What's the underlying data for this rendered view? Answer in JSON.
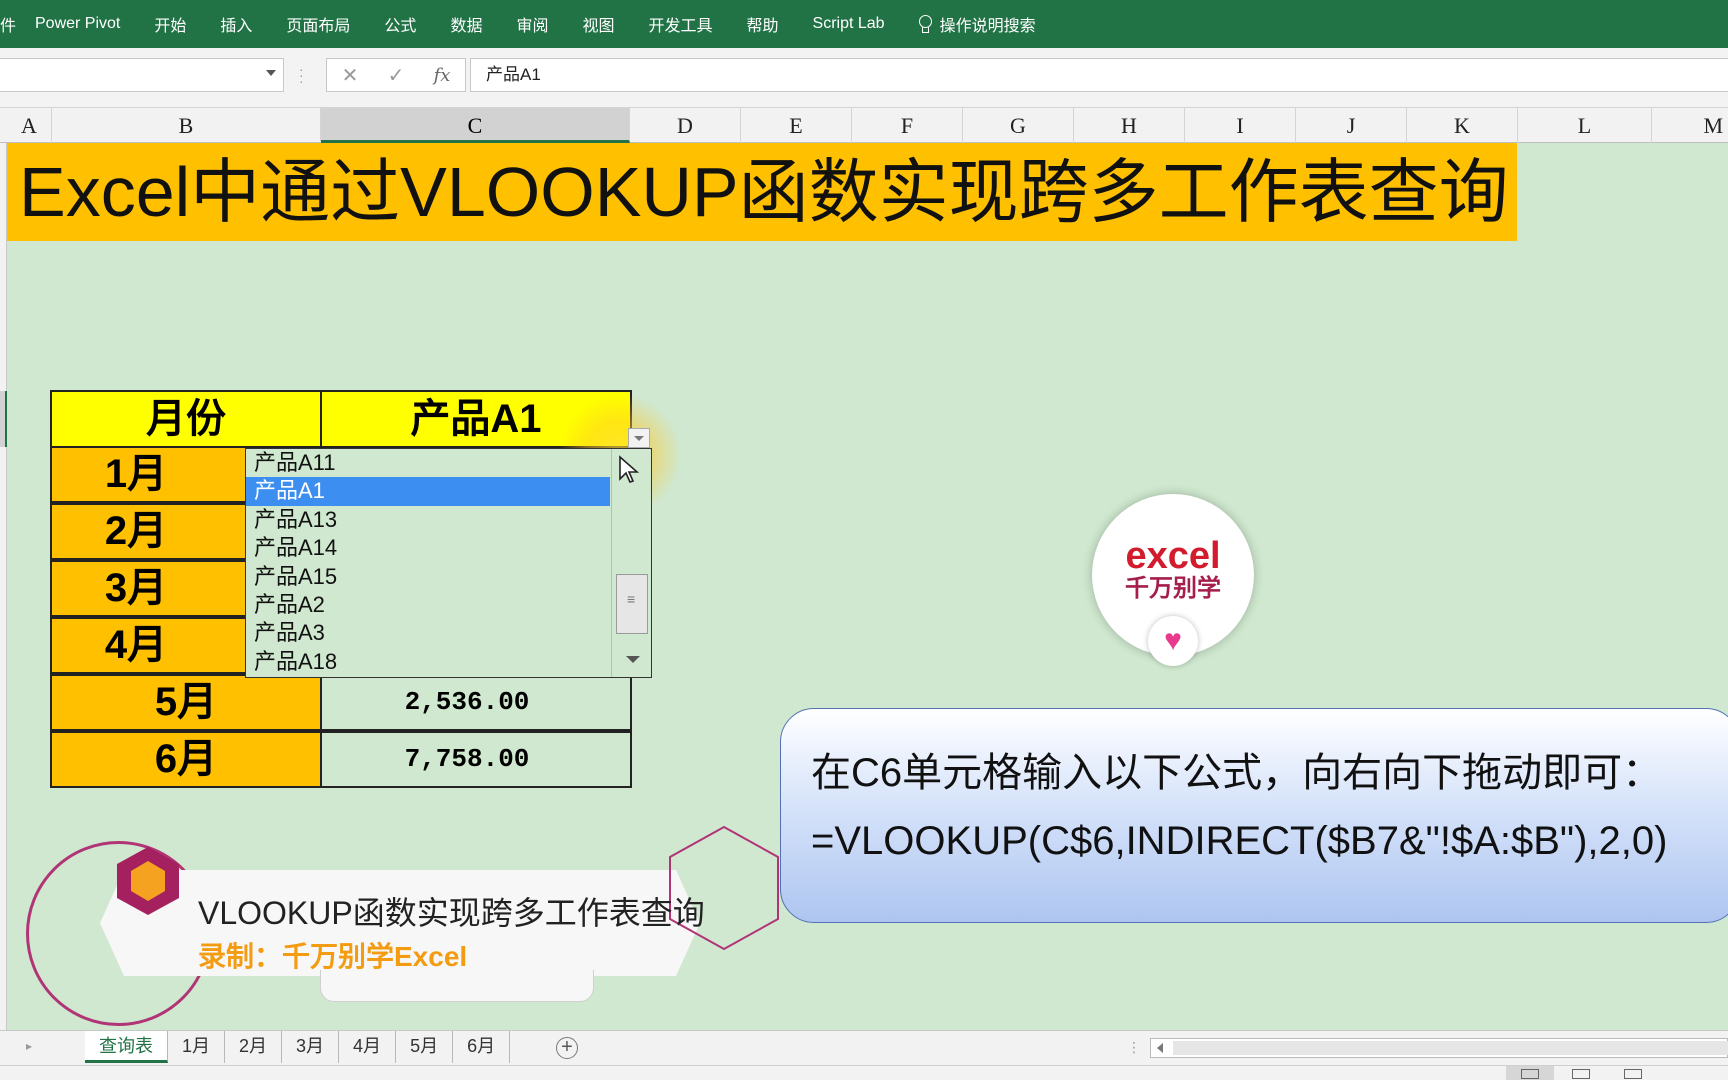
{
  "ribbon": {
    "cut_label": "件",
    "tabs": [
      "Power Pivot",
      "开始",
      "插入",
      "页面布局",
      "公式",
      "数据",
      "审阅",
      "视图",
      "开发工具",
      "帮助",
      "Script Lab"
    ],
    "search_label": "操作说明搜索"
  },
  "formula_bar": {
    "name_box": "",
    "cancel_icon": "✕",
    "enter_icon": "✓",
    "fx_label": "fx",
    "content": "产品A1"
  },
  "columns": [
    "A",
    "B",
    "C",
    "D",
    "E",
    "F",
    "G",
    "H",
    "I",
    "J",
    "K",
    "L",
    "M"
  ],
  "selected_column": "C",
  "banner_title": "Excel中通过VLOOKUP函数实现跨多工作表查询",
  "table": {
    "header_month": "月份",
    "header_product": "产品A1",
    "rows": [
      {
        "month": "1月",
        "value": ""
      },
      {
        "month": "2月",
        "value": ""
      },
      {
        "month": "3月",
        "value": ""
      },
      {
        "month": "4月",
        "value": ""
      },
      {
        "month": "5月",
        "value": "2,536.00"
      },
      {
        "month": "6月",
        "value": "7,758.00"
      }
    ]
  },
  "dropdown": {
    "items": [
      "产品A11",
      "产品A1",
      "产品A13",
      "产品A14",
      "产品A15",
      "产品A2",
      "产品A3",
      "产品A18"
    ],
    "selected": "产品A1"
  },
  "logo": {
    "line1": "excel",
    "line2": "千万别学"
  },
  "callout": {
    "line1": "在C6单元格输入以下公式，向右向下拖动即可：",
    "line2": "=VLOOKUP(C$6,INDIRECT($B7&\"!$A:$B\"),2,0)"
  },
  "caption": {
    "title": "VLOOKUP函数实现跨多工作表查询",
    "author": "录制：千万别学Excel"
  },
  "sheets": [
    "查询表",
    "1月",
    "2月",
    "3月",
    "4月",
    "5月",
    "6月"
  ],
  "active_sheet": "查询表",
  "colors": {
    "excel_green": "#217346",
    "header_yellow": "#ffff00",
    "month_orange": "#ffc000",
    "list_highlight": "#3c8ff0"
  }
}
